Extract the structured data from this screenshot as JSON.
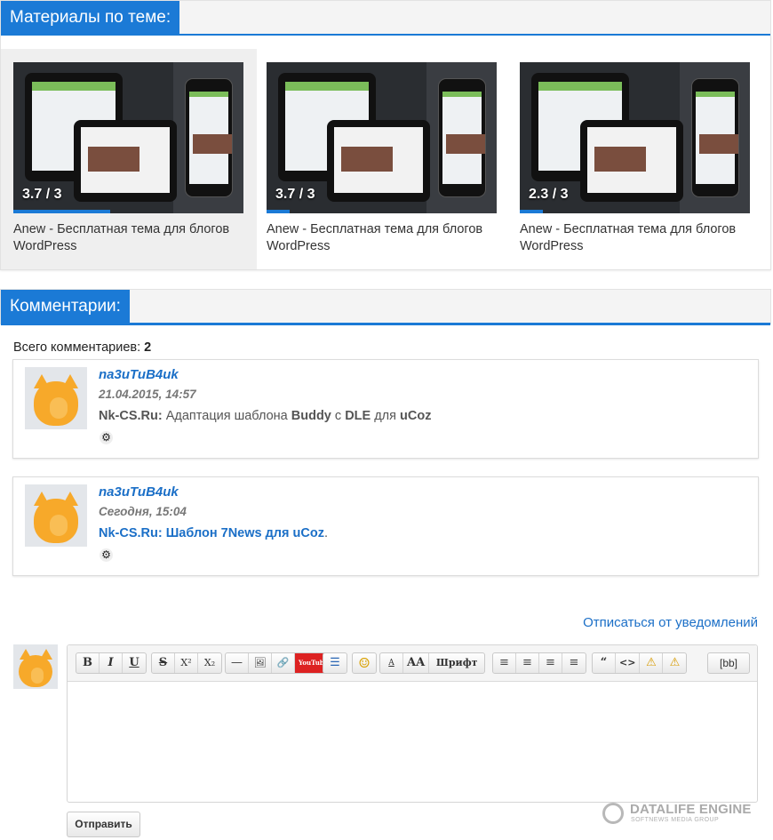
{
  "related": {
    "header": "Материалы по теме:",
    "items": [
      {
        "title": "Anew - Бесплатная тема для блогов WordPress",
        "rating": "3.7 / 3",
        "progress": 0.42
      },
      {
        "title": "Anew - Бесплатная тема для блогов WordPress",
        "rating": "3.7 / 3",
        "progress": 0.1
      },
      {
        "title": "Anew - Бесплатная тема для блогов WordPress",
        "rating": "2.3 / 3",
        "progress": 0.1
      }
    ]
  },
  "comments": {
    "header": "Комментарии:",
    "total_label": "Всего комментариев:",
    "total_count": "2",
    "items": [
      {
        "author": "na3uTuB4uk",
        "date": "21.04.2015, 14:57",
        "site": "Nk-CS.Ru:",
        "text_parts": [
          "Адаптация шаблона",
          "Buddy",
          "с",
          "DLE",
          "для",
          "uCoz"
        ]
      },
      {
        "author": "na3uTuB4uk",
        "date": "Сегодня, 15:04",
        "site": "Nk-CS.Ru:",
        "text_parts": [
          "Шаблон 7News для uCoz",
          "."
        ]
      }
    ],
    "gear_icon": "gear-icon"
  },
  "unsubscribe": "Отписаться от уведомлений",
  "editor": {
    "groups": [
      [
        "B",
        "I",
        "U"
      ],
      [
        "S",
        "X²",
        "X₂"
      ],
      [
        "—",
        "🖼",
        "🔗",
        "YouTube"
      ],
      [
        "☰"
      ],
      [
        "☺"
      ],
      [
        "A",
        "AA",
        "Шрифт"
      ],
      [
        "≡",
        "≡",
        "≡",
        "≡"
      ],
      [
        "“",
        "<>",
        "⚠",
        "⚠"
      ],
      [
        "[bb]"
      ]
    ],
    "send_label": "Отправить"
  },
  "watermark": {
    "name": "DATALIFE ENGINE",
    "sub": "SOFTNEWS MEDIA GROUP"
  },
  "colors": {
    "accent": "#1b7ad6",
    "link": "#1b6fc7"
  }
}
